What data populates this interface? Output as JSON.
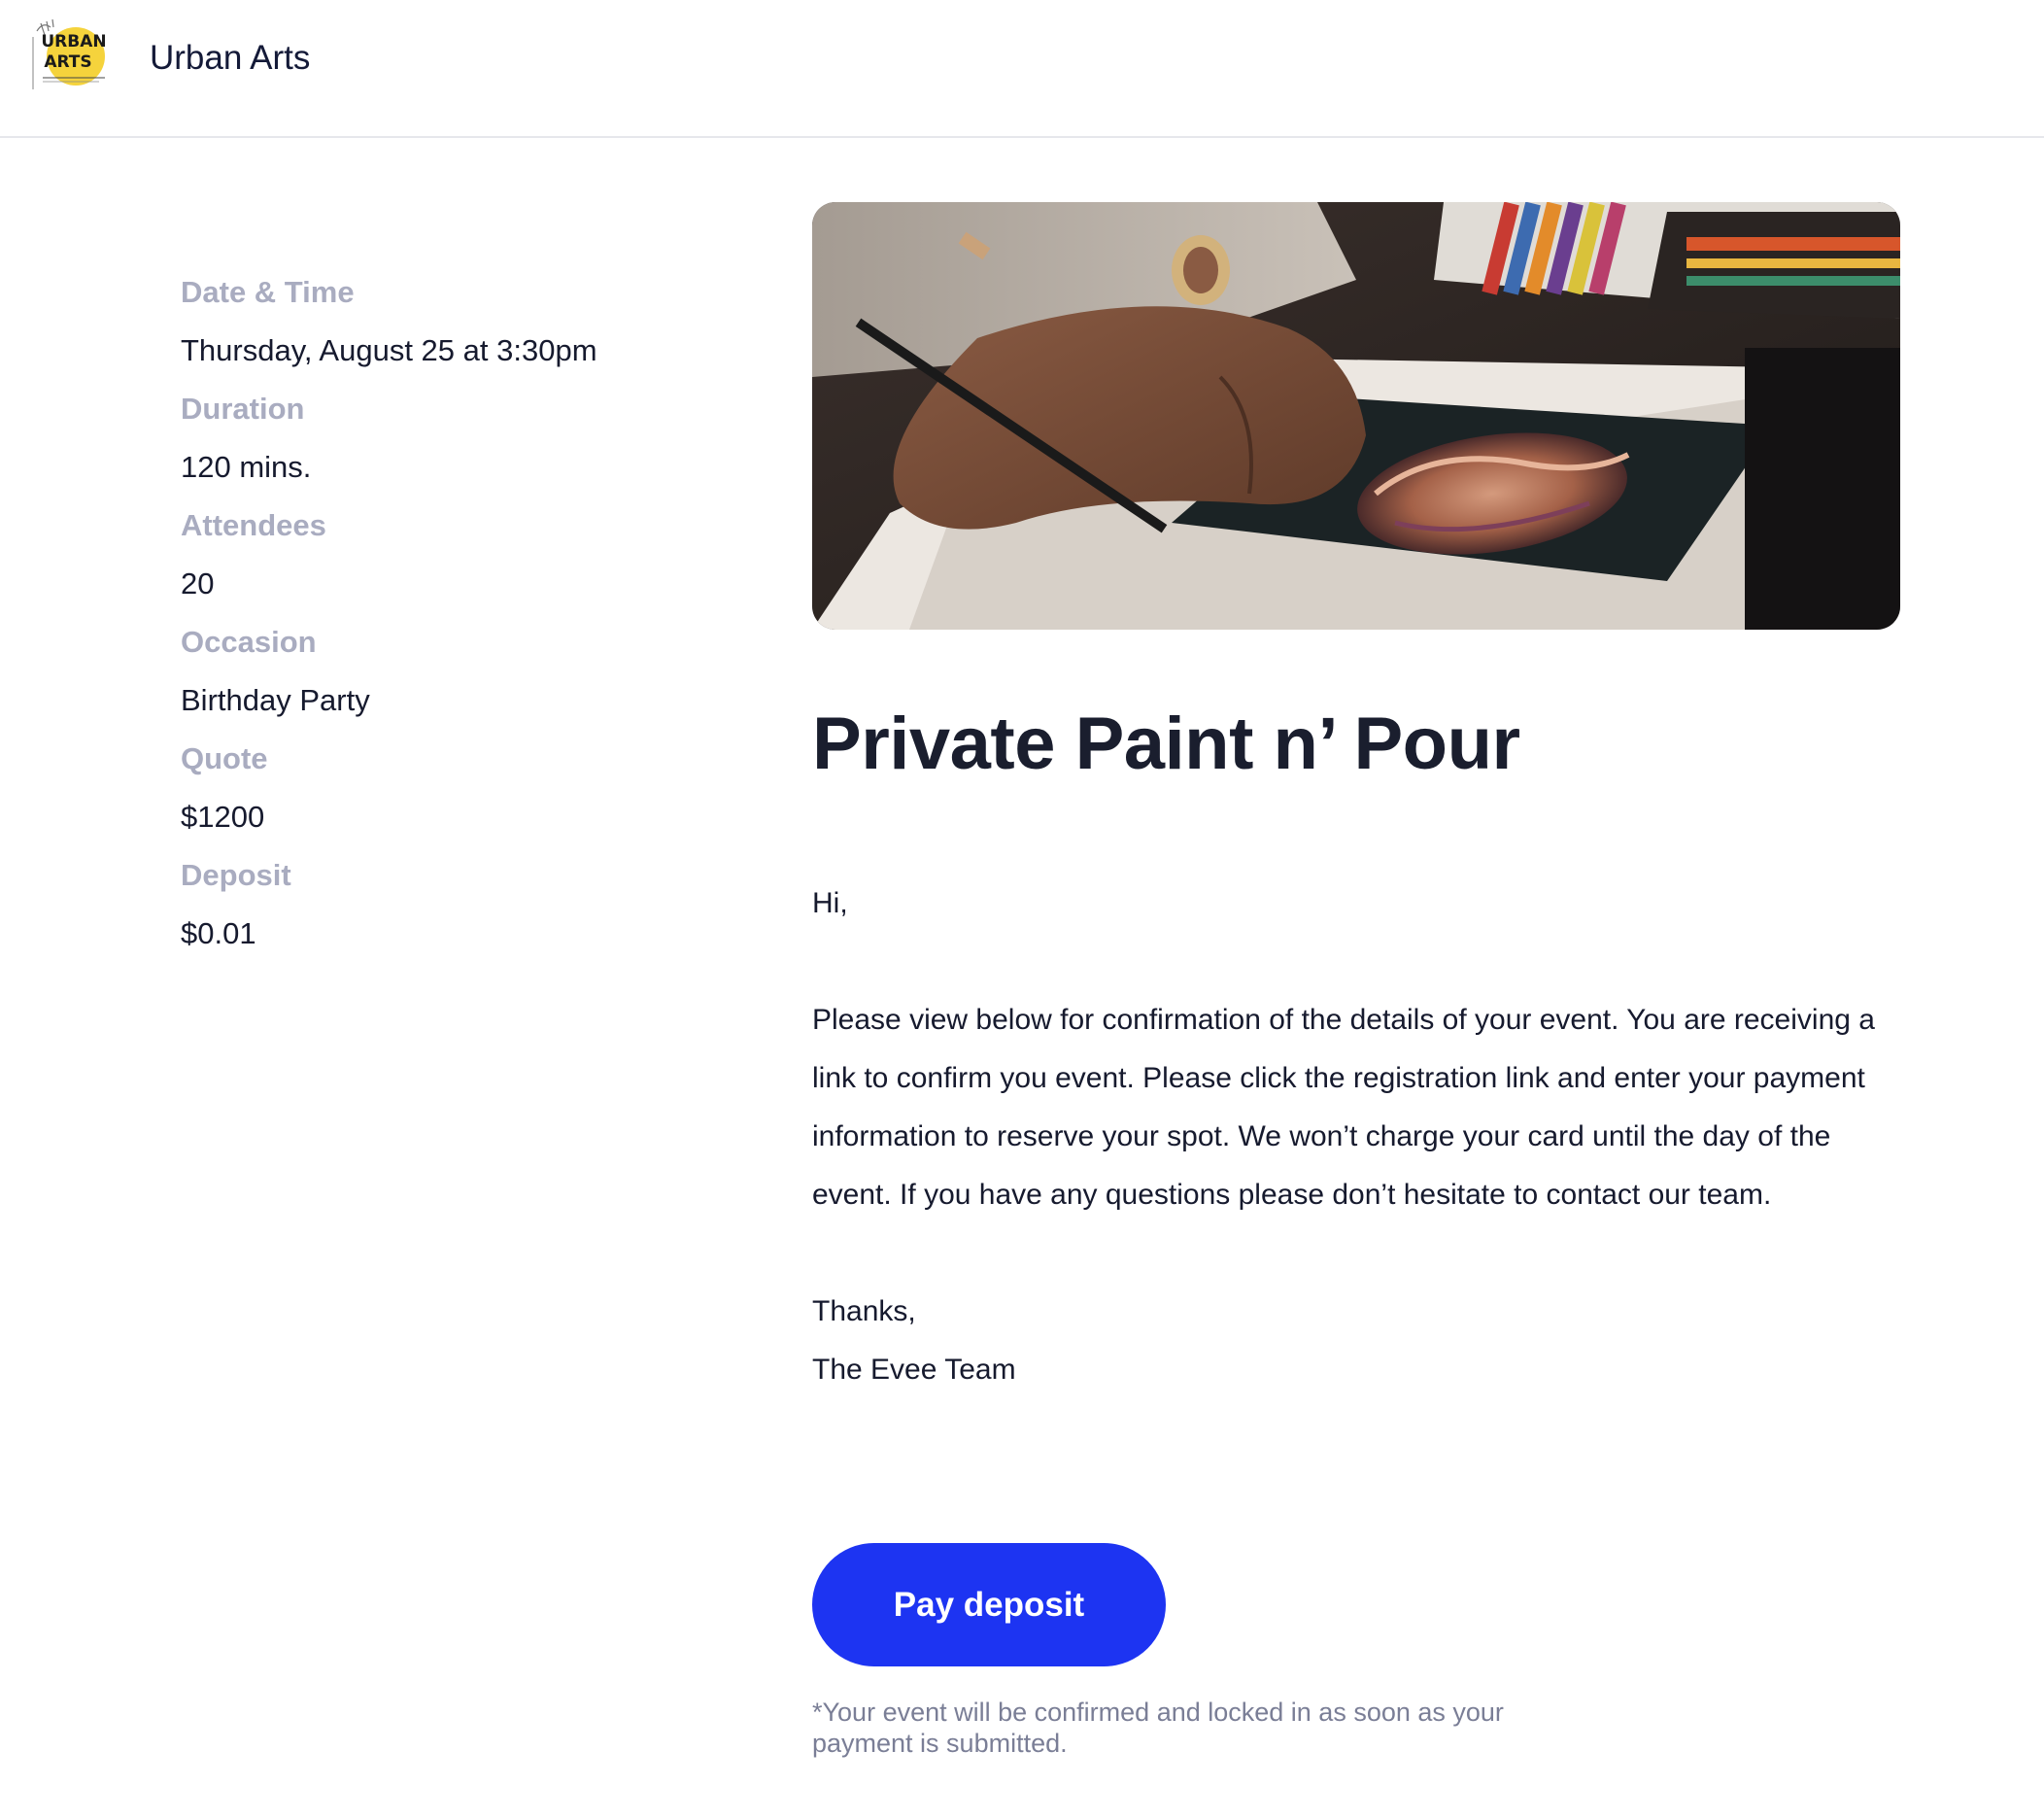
{
  "header": {
    "brand_name": "Urban Arts",
    "logo_text_line1": "URBAN",
    "logo_text_line2": "ARTS"
  },
  "details": [
    {
      "label": "Date & Time",
      "value": "Thursday, August 25 at 3:30pm"
    },
    {
      "label": "Duration",
      "value": "120 mins."
    },
    {
      "label": "Attendees",
      "value": "20"
    },
    {
      "label": "Occasion",
      "value": "Birthday Party"
    },
    {
      "label": "Quote",
      "value": "$1200"
    },
    {
      "label": "Deposit",
      "value": "$0.01"
    }
  ],
  "event": {
    "title": "Private Paint n’ Pour",
    "greeting": "Hi,",
    "body": "Please view below for confirmation of the details of your event. You are receiving a link to confirm you event. Please click the registration link and enter your payment information to reserve your spot. We won’t charge your card until the day of the event. If you have any questions please don’t hesitate to contact our team.",
    "signoff_line1": "Thanks,",
    "signoff_line2": "The Evee Team"
  },
  "actions": {
    "pay_label": "Pay deposit",
    "note": "*Your event will be confirmed and locked in as soon as your payment is submitted."
  },
  "colors": {
    "accent": "#1d34f2",
    "label": "#a9acc0",
    "text": "#161a2e",
    "logo_yellow": "#f5d33c"
  }
}
